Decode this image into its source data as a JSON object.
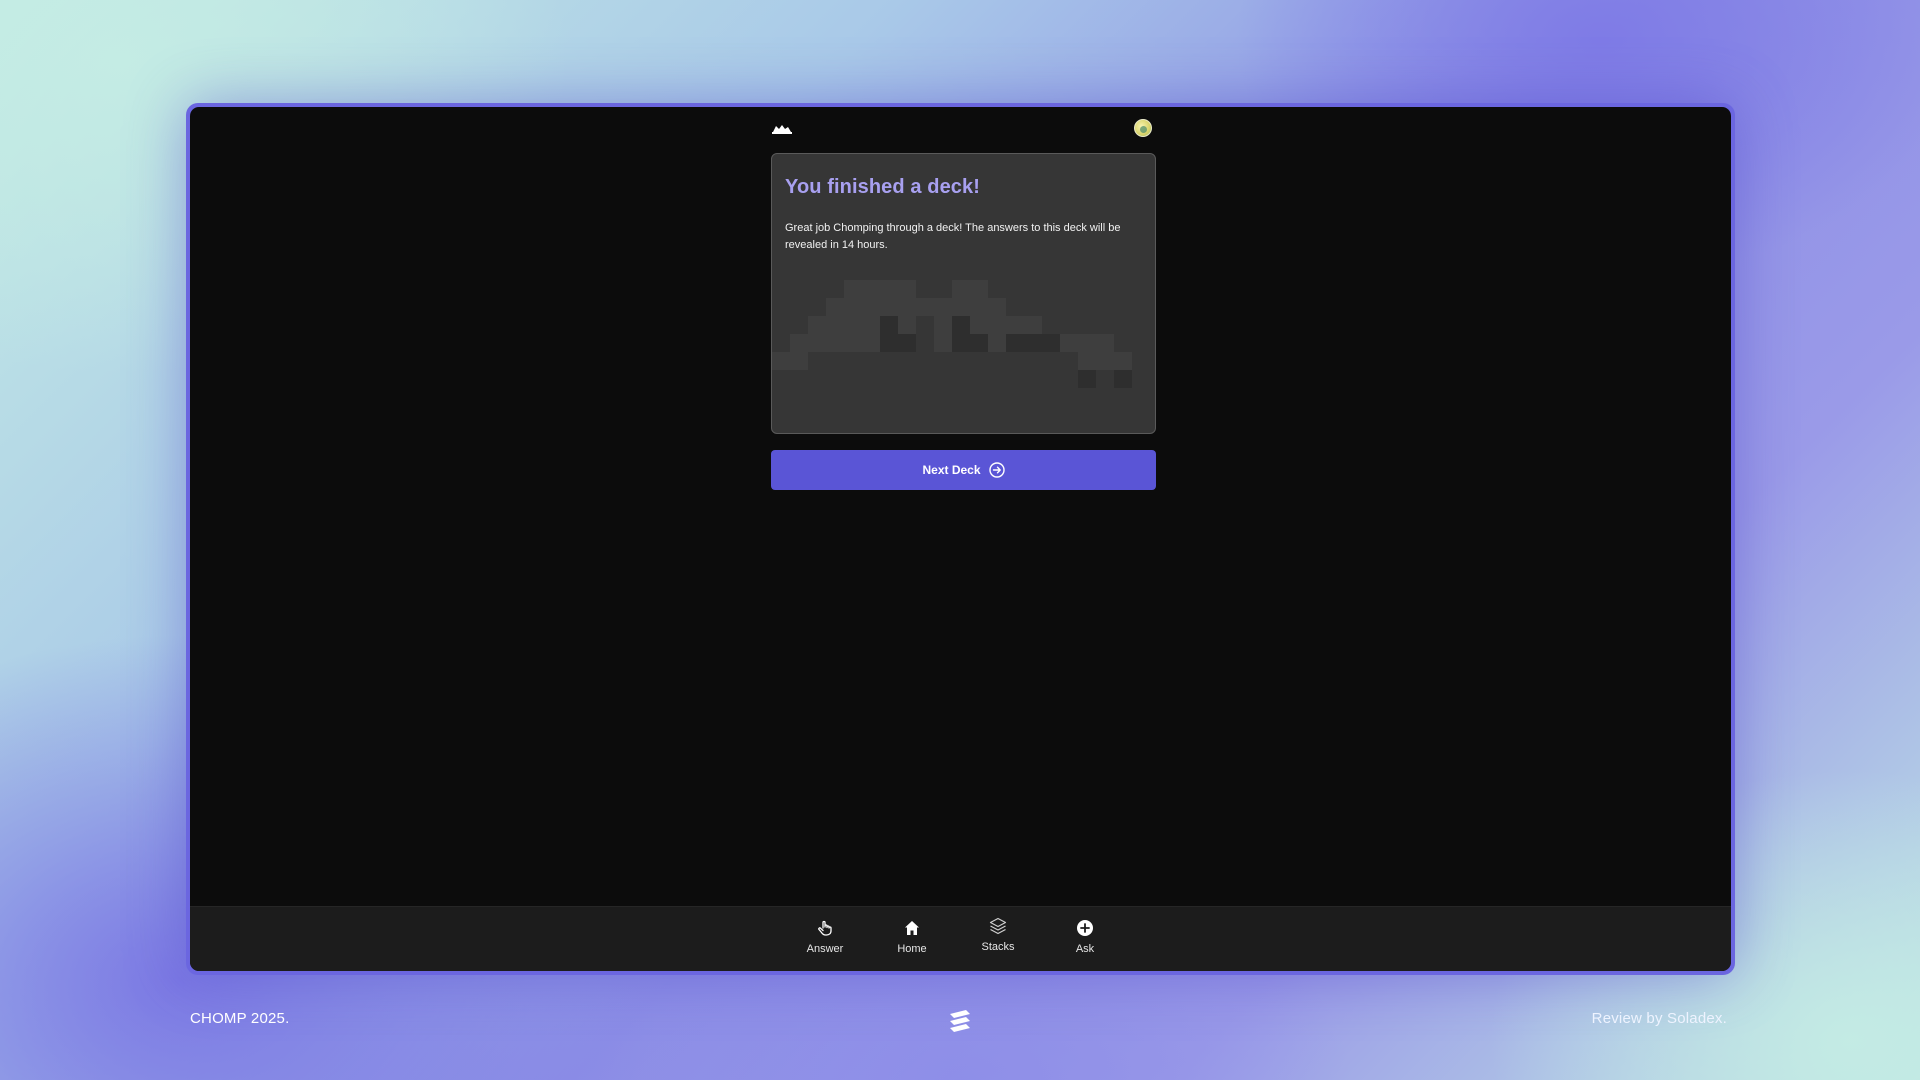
{
  "app": {
    "logo_icon": "chomp-logo-icon",
    "avatar_icon": "user-avatar"
  },
  "card": {
    "title": "You finished a deck!",
    "message": "Great job Chomping through a deck! The answers to this deck will be revealed in 14 hours."
  },
  "primary_action": {
    "label": "Next Deck",
    "icon": "arrow-right-circle-icon"
  },
  "bottom_nav": {
    "items": [
      {
        "label": "Answer",
        "icon": "hand-pointer-icon"
      },
      {
        "label": "Home",
        "icon": "home-icon"
      },
      {
        "label": "Stacks",
        "icon": "stack-layers-icon"
      },
      {
        "label": "Ask",
        "icon": "plus-circle-icon"
      }
    ]
  },
  "footer": {
    "left_text": "CHOMP 2025.",
    "right_text": "Review by Soladex.",
    "center_icon": "soladex-logo-icon"
  },
  "colors": {
    "accent": "#5a55d6",
    "title_purple": "#a8a0f0",
    "screen_bg": "#0c0c0c",
    "card_bg": "#363636",
    "nav_bg": "#1c1c1c",
    "frame": "#6b66e0"
  }
}
